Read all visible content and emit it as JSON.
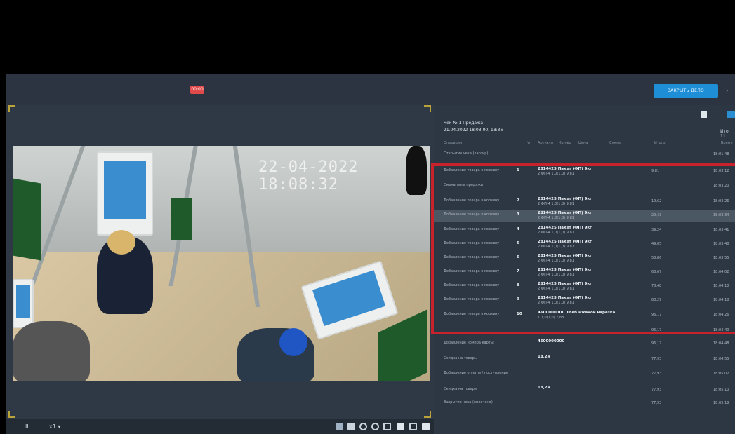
{
  "topbar": {
    "rec_label": "00:00",
    "action_label": "ЗАКРЫТЬ ДЕЛО",
    "more_label": "›"
  },
  "video": {
    "timestamp": "22-04-2022 18:08:32"
  },
  "toolbar": {
    "play_label": "II",
    "speed_label": "x1 ▾"
  },
  "receipt": {
    "title": "Чек № 1 Продажа",
    "date": "21.04.2022 18:03:00, 18:36",
    "meta": "Итог 11",
    "columns": [
      "Операция",
      "№",
      "Артикул",
      "Кол-во",
      "Цена",
      "Сумма",
      "Итого",
      "Время"
    ],
    "rows": [
      {
        "op": "Открытие чека (кассир)",
        "num": "",
        "line1": "",
        "line2": "",
        "sum": "",
        "time": "18:01:48"
      },
      {
        "op": "Добавление товара в корзину",
        "num": "1",
        "line1": "2814425 Пакет (ФП) 9кг",
        "line2": "2 ФП-4   1,0(1,0)   9,81",
        "sum": "9,81",
        "time": "18:03:12"
      },
      {
        "op": "Смена типа продажи",
        "num": "",
        "line1": "",
        "line2": "",
        "sum": "",
        "time": "18:03:20"
      },
      {
        "op": "Добавление товара в корзину",
        "num": "2",
        "line1": "2814425 Пакет (ФП) 9кг",
        "line2": "2 ФП-4   1,0(1,0)   9,81",
        "sum": "19,62",
        "time": "18:03:26"
      },
      {
        "op": "Добавление товара в корзину",
        "num": "3",
        "line1": "2814425 Пакет (ФП) 9кг",
        "line2": "2 ФП-4   1,0(1,0)   9,81",
        "sum": "29,43",
        "time": "18:03:34"
      },
      {
        "op": "Добавление товара в корзину",
        "num": "4",
        "line1": "2814425 Пакет (ФП) 9кг",
        "line2": "2 ФП-4   1,0(1,0)   9,81",
        "sum": "39,24",
        "time": "18:03:41"
      },
      {
        "op": "Добавление товара в корзину",
        "num": "5",
        "line1": "2814425 Пакет (ФП) 9кг",
        "line2": "2 ФП-4   1,0(1,0)   9,81",
        "sum": "49,05",
        "time": "18:03:48"
      },
      {
        "op": "Добавление товара в корзину",
        "num": "6",
        "line1": "2814425 Пакет (ФП) 9кг",
        "line2": "2 ФП-4   1,0(1,0)   9,81",
        "sum": "58,86",
        "time": "18:03:55"
      },
      {
        "op": "Добавление товара в корзину",
        "num": "7",
        "line1": "2814425 Пакет (ФП) 9кг",
        "line2": "2 ФП-4   1,0(1,0)   9,81",
        "sum": "68,67",
        "time": "18:04:02"
      },
      {
        "op": "Добавление товара в корзину",
        "num": "8",
        "line1": "2814425 Пакет (ФП) 9кг",
        "line2": "2 ФП-4   1,0(1,0)   9,81",
        "sum": "78,48",
        "time": "18:04:10"
      },
      {
        "op": "Добавление товара в корзину",
        "num": "9",
        "line1": "2814425 Пакет (ФП) 9кг",
        "line2": "2 ФП-4   1,0(1,0)   9,81",
        "sum": "88,29",
        "time": "18:04:18"
      },
      {
        "op": "Добавление товара в корзину",
        "num": "10",
        "line1": "4600000000 Хлеб Ржаной нарезка",
        "line2": "1   1,0(1,0)   7,88",
        "sum": "96,17",
        "time": "18:04:26"
      },
      {
        "op": "",
        "num": "",
        "line1": "",
        "line2": "",
        "sum": "96,17",
        "time": "18:04:40"
      },
      {
        "op": "Добавление номера карты",
        "num": "",
        "line1": "4600000000",
        "line2": "",
        "sum": "96,17",
        "time": "18:04:48"
      },
      {
        "op": "Скидка на товары",
        "num": "",
        "line1": "18,24",
        "line2": "",
        "sum": "77,93",
        "time": "18:04:55"
      },
      {
        "op": "Добавление оплаты / поступление",
        "num": "",
        "line1": "",
        "line2": "",
        "sum": "77,93",
        "time": "18:05:02"
      },
      {
        "op": "Скидка на товары",
        "num": "",
        "line1": "18,24",
        "line2": "",
        "sum": "77,93",
        "time": "18:05:10"
      },
      {
        "op": "Закрытие чека (оплачено)",
        "num": "",
        "line1": "",
        "line2": "",
        "sum": "77,93",
        "time": "18:05:18"
      }
    ]
  }
}
